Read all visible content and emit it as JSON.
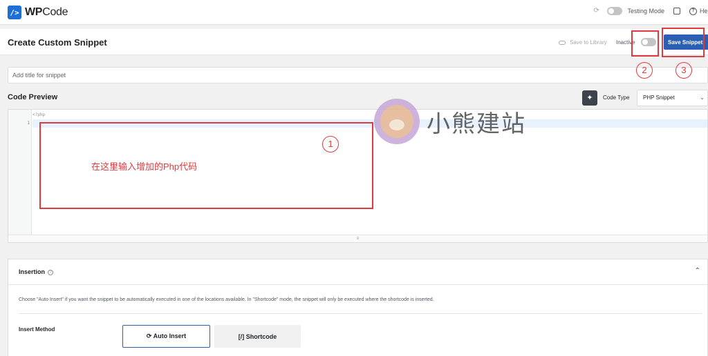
{
  "app": {
    "logo_mark": "/>",
    "logo_bold": "WP",
    "logo_rest": "Code"
  },
  "topbar": {
    "testing_mode_label": "Testing Mode",
    "help_label": "Help",
    "sync_icon": "sync-icon",
    "inbox_icon": "inbox-icon",
    "help_icon": "help-circle-icon"
  },
  "header": {
    "page_title": "Create Custom Snippet",
    "save_to_library_label": "Save to Library",
    "status_label": "Inactive",
    "save_button_label": "Save Snippet"
  },
  "snippet": {
    "title_placeholder": "Add title for snippet"
  },
  "code_preview": {
    "section_title": "Code Preview",
    "ai_button_glyph": "✦",
    "code_type_label": "Code Type",
    "code_type_selected": "PHP Snippet",
    "first_line": "<?php",
    "line_numbers": [
      "1"
    ],
    "resize_handle": "≡"
  },
  "annotations": {
    "instruction_text": "在这里输入增加的Php代码",
    "markers": [
      "1",
      "2",
      "3"
    ],
    "color": "#e0393e"
  },
  "watermark": {
    "text": "小熊建站"
  },
  "insertion": {
    "title": "Insertion",
    "help_glyph": "?",
    "description": "Choose \"Auto Insert\" if you want the snippet to be automatically executed in one of the locations available. In \"Shortcode\" mode, the snippet will only be executed where the shortcode is inserted.",
    "insert_method_label": "Insert Method",
    "auto_insert_label": "Auto Insert",
    "shortcode_label": "Shortcode"
  },
  "colors": {
    "accent": "#2b5fb4",
    "logo": "#1d6fd8",
    "annotation": "#e0393e"
  }
}
